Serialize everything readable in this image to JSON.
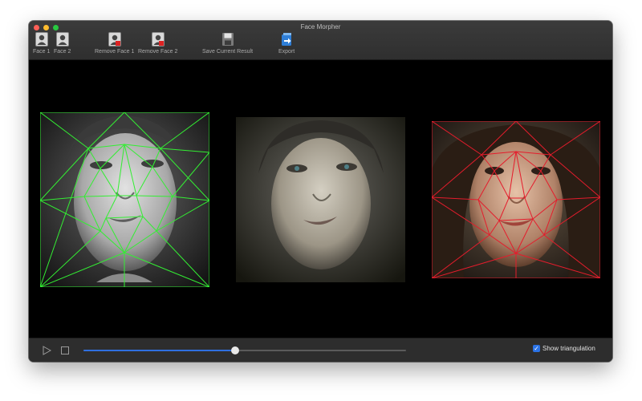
{
  "window": {
    "title": "Face Morpher"
  },
  "toolbar": {
    "face1": "Face 1",
    "face2": "Face 2",
    "remove_face1": "Remove Face 1",
    "remove_face2": "Remove Face 2",
    "save_result": "Save Current Result",
    "export": "Export"
  },
  "bottom": {
    "show_triangulation_label": "Show triangulation",
    "show_triangulation_checked": true,
    "progress": 0.47
  },
  "colors": {
    "face1_mesh": "#33ee33",
    "face2_mesh": "#e51c2c",
    "slider_accent": "#2f6fe0",
    "checkbox_accent": "#2a72e5"
  },
  "icons": {
    "face1": "person-portrait-icon",
    "face2": "person-portrait-icon",
    "remove_face1": "remove-person-icon",
    "remove_face2": "remove-person-icon",
    "save": "floppy-disk-icon",
    "export": "export-arrow-icon",
    "play": "play-icon",
    "stop": "stop-icon"
  }
}
